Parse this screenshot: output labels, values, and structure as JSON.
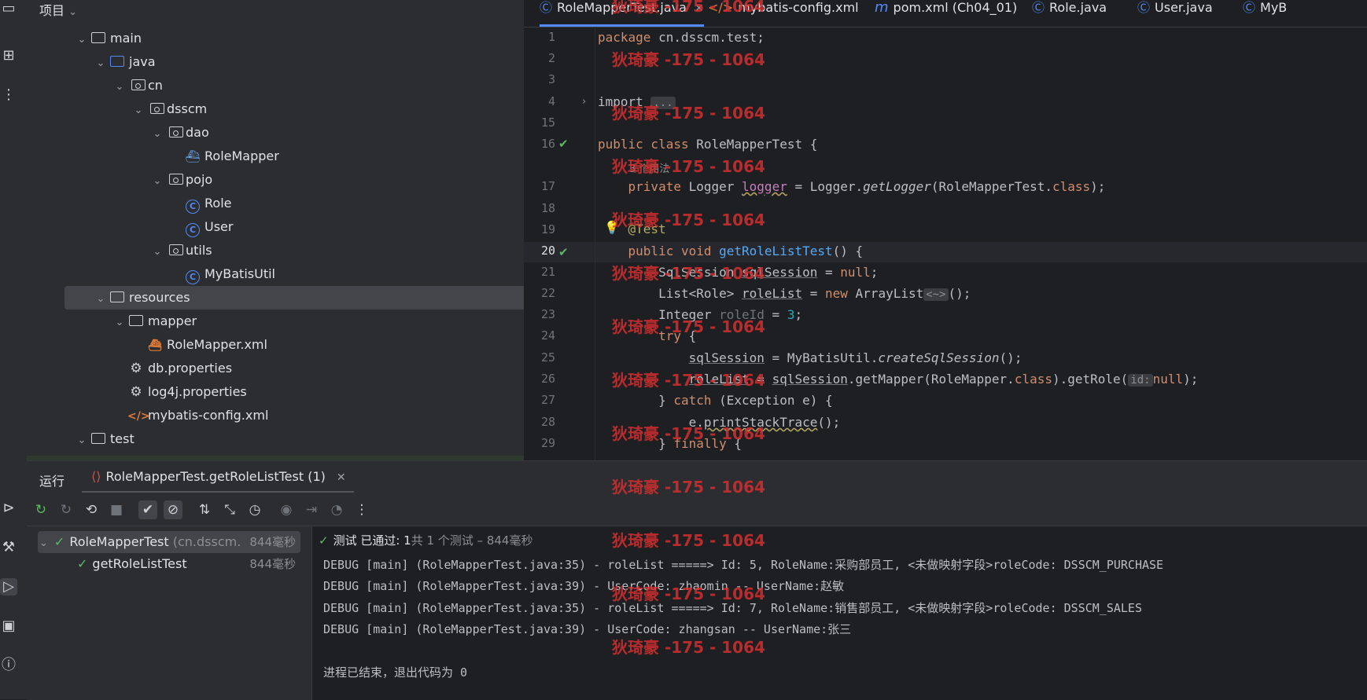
{
  "project_panel": {
    "title": "项目",
    "tree": [
      {
        "label": "main",
        "kind": "folder",
        "level": 3
      },
      {
        "label": "java",
        "kind": "folder-blue",
        "level": 4
      },
      {
        "label": "cn",
        "kind": "package",
        "level": 5
      },
      {
        "label": "dsscm",
        "kind": "package",
        "level": 6
      },
      {
        "label": "dao",
        "kind": "package",
        "level": 7
      },
      {
        "label": "RoleMapper",
        "kind": "mapper",
        "level": 8
      },
      {
        "label": "pojo",
        "kind": "package",
        "level": 7
      },
      {
        "label": "Role",
        "kind": "class",
        "level": 8
      },
      {
        "label": "User",
        "kind": "class",
        "level": 8
      },
      {
        "label": "utils",
        "kind": "package",
        "level": 7
      },
      {
        "label": "MyBatisUtil",
        "kind": "class",
        "level": 8
      },
      {
        "label": "resources",
        "kind": "resources",
        "level": 4
      },
      {
        "label": "mapper",
        "kind": "folder",
        "level": 5
      },
      {
        "label": "RoleMapper.xml",
        "kind": "mapper-xml",
        "level": 6
      },
      {
        "label": "db.properties",
        "kind": "properties",
        "level": 5
      },
      {
        "label": "log4j.properties",
        "kind": "properties",
        "level": 5
      },
      {
        "label": "mybatis-config.xml",
        "kind": "xml",
        "level": 5
      },
      {
        "label": "test",
        "kind": "folder",
        "level": 3
      }
    ]
  },
  "editor": {
    "tabs": [
      {
        "label": "RoleMapperTest.java",
        "icon": "class-icon",
        "active": true
      },
      {
        "label": "mybatis-config.xml",
        "icon": "xml-icon",
        "active": false
      },
      {
        "label": "pom.xml (Ch04_01)",
        "icon": "maven-icon",
        "active": false
      },
      {
        "label": "Role.java",
        "icon": "class-icon",
        "active": false
      },
      {
        "label": "User.java",
        "icon": "class-icon",
        "active": false
      },
      {
        "label": "MyB",
        "icon": "class-icon",
        "active": false
      }
    ],
    "line_numbers": [
      "1",
      "2",
      "3",
      "4",
      "15",
      "16",
      "17",
      "18",
      "19",
      "20",
      "21",
      "22",
      "23",
      "24",
      "25",
      "26",
      "27",
      "28",
      "29"
    ],
    "usage_hint": "3 个用法",
    "import_fold": "...",
    "param_hint": "id:",
    "diamond_hint": "<~>",
    "code": {
      "l1_kw": "package",
      "l1_rest": " cn.dsscm.test;",
      "l4_kw": "import",
      "l16_kw1": "public",
      "l16_kw2": " class",
      "l16_rest": " RoleMapperTest {",
      "l17_kw": "private",
      "l17_type": " Logger ",
      "l17_field": "logger",
      "l17_mid": " = Logger.",
      "l17_call": "getLogger",
      "l17_arg": "(RoleMapperTest.",
      "l17_cls": "class",
      "l17_end": ");",
      "l19_ann": "@Test",
      "l20_kw1": "public",
      "l20_kw2": " void ",
      "l20_fn": "getRoleListTest",
      "l20_end": "() {",
      "l21_a": "SqlSession ",
      "l21_b": "sqlSession",
      "l21_c": " = ",
      "l21_d": "null",
      "l21_e": ";",
      "l22_a": "List<Role> ",
      "l22_b": "roleList",
      "l22_c": " = ",
      "l22_d": "new",
      "l22_e": " ArrayList",
      "l22_f": "();",
      "l23_a": "Integer ",
      "l23_b": "roleId",
      "l23_c": " = ",
      "l23_d": "3",
      "l23_e": ";",
      "l24_kw": "try",
      "l24_rest": " {",
      "l25_a": "sqlSession",
      "l25_b": " = MyBatisUtil.",
      "l25_c": "createSqlSession",
      "l25_d": "();",
      "l26_a": "roleList",
      "l26_b": " = ",
      "l26_c": "sqlSession",
      "l26_d": ".getMapper(RoleMapper.",
      "l26_e": "class",
      "l26_f": ").getRole(",
      "l26_g": "null",
      "l26_h": ");",
      "l27_a": "} ",
      "l27_kw": "catch",
      "l27_rest": " (Exception e) {",
      "l28_a": "e.",
      "l28_b": "printStackTrace",
      "l28_c": "();",
      "l29_a": "} ",
      "l29_kw": "finally",
      "l29_rest": " {"
    }
  },
  "watermark": "狄琦豪 -175 - 1064",
  "run_panel": {
    "title": "运行",
    "tab_label": "RoleMapperTest.getRoleListTest (1)",
    "status_prefix": "测试 已通过: ",
    "status_count": "1",
    "status_suffix": "共 1 个测试 – 844毫秒",
    "tests": [
      {
        "name": "RoleMapperTest",
        "detail": "(cn.dsscm.",
        "time": "844毫秒"
      },
      {
        "name": "getRoleListTest",
        "detail": "",
        "time": "844毫秒"
      }
    ],
    "console_lines": [
      "DEBUG [main] (RoleMapperTest.java:35) - roleList =====> Id: 5, RoleName:采购部员工, <未做映射字段>roleCode: DSSCM_PURCHASE",
      "DEBUG [main] (RoleMapperTest.java:39) - UserCode: zhaomin -- UserName:赵敏",
      "DEBUG [main] (RoleMapperTest.java:35) - roleList =====> Id: 7, RoleName:销售部员工, <未做映射字段>roleCode: DSSCM_SALES",
      "DEBUG [main] (RoleMapperTest.java:39) - UserCode: zhangsan -- UserName:张三",
      "",
      "进程已结束，退出代码为 0"
    ]
  },
  "colors": {
    "accent": "#548af7",
    "pass": "#5fb865",
    "watermark": "#d32f2f"
  }
}
